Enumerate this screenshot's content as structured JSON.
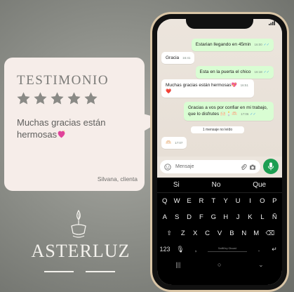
{
  "testimonial": {
    "title": "TESTIMONIO",
    "rating": 5,
    "text": "Muchas gracias están hermosas",
    "author": "Silvana, clienta",
    "star_color": "#8a8a86",
    "heart_icon": "sparkling-heart-icon"
  },
  "logo": {
    "name": "ASTERLUZ",
    "icon": "candle-icon"
  },
  "phone": {
    "messages": [
      {
        "dir": "out",
        "text": "Estarian llegando en 45min",
        "time": "16:00"
      },
      {
        "dir": "in",
        "text": "Gracia",
        "time": "16:41"
      },
      {
        "dir": "out",
        "text": "Esta en la puerta el chico",
        "time": "16:18"
      },
      {
        "dir": "in",
        "text": "Muchas gracias están  hermosas💖",
        "time": "16:51",
        "extra": "❤️"
      },
      {
        "dir": "out",
        "text": "Gracias a vos por confiar en mi trabajo, que lo disfrutes 🙌🏻🕯️🫶🏻",
        "time": "17:06"
      },
      {
        "dir": "in",
        "text": "🫶🏻",
        "time": "17:07"
      }
    ],
    "unread_notice": "1 mensaje no leído",
    "input_placeholder": "Mensaje",
    "keyboard": {
      "suggestions": [
        "Si",
        "No",
        "Que"
      ],
      "row1": [
        "Q",
        "W",
        "E",
        "R",
        "T",
        "Y",
        "U",
        "I",
        "O",
        "P"
      ],
      "row2": [
        "A",
        "S",
        "D",
        "F",
        "G",
        "H",
        "J",
        "K",
        "L",
        "Ñ"
      ],
      "row3": [
        "Z",
        "X",
        "C",
        "V",
        "B",
        "N",
        "M"
      ],
      "numbers_key": "123",
      "space_label": "SwiftKey Gboard",
      "period_key": "."
    },
    "colors": {
      "outgoing_bubble": "#d9fdd3",
      "incoming_bubble": "#ffffff",
      "send_button": "#1d9e52",
      "phone_frame": "#d9c5a6"
    }
  }
}
